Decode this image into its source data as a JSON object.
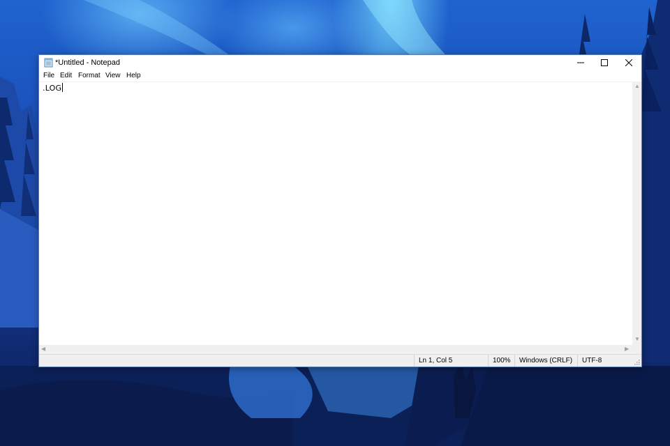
{
  "window": {
    "title": "*Untitled - Notepad",
    "icon": "notepad-icon",
    "controls": [
      "minimize-icon",
      "maximize-icon",
      "close-icon"
    ]
  },
  "menu": {
    "file": "File",
    "edit": "Edit",
    "format": "Format",
    "view": "View",
    "help": "Help"
  },
  "editor": {
    "content": ".LOG"
  },
  "status": {
    "position": "Ln 1, Col 5",
    "zoom": "100%",
    "line_ending": "Windows (CRLF)",
    "encoding": "UTF-8"
  },
  "colors": {
    "desktop_top": "#1f63cf",
    "desktop_bottom": "#0b1c52",
    "window_bg": "#ffffff",
    "statusbar_bg": "#f0f0f0"
  }
}
